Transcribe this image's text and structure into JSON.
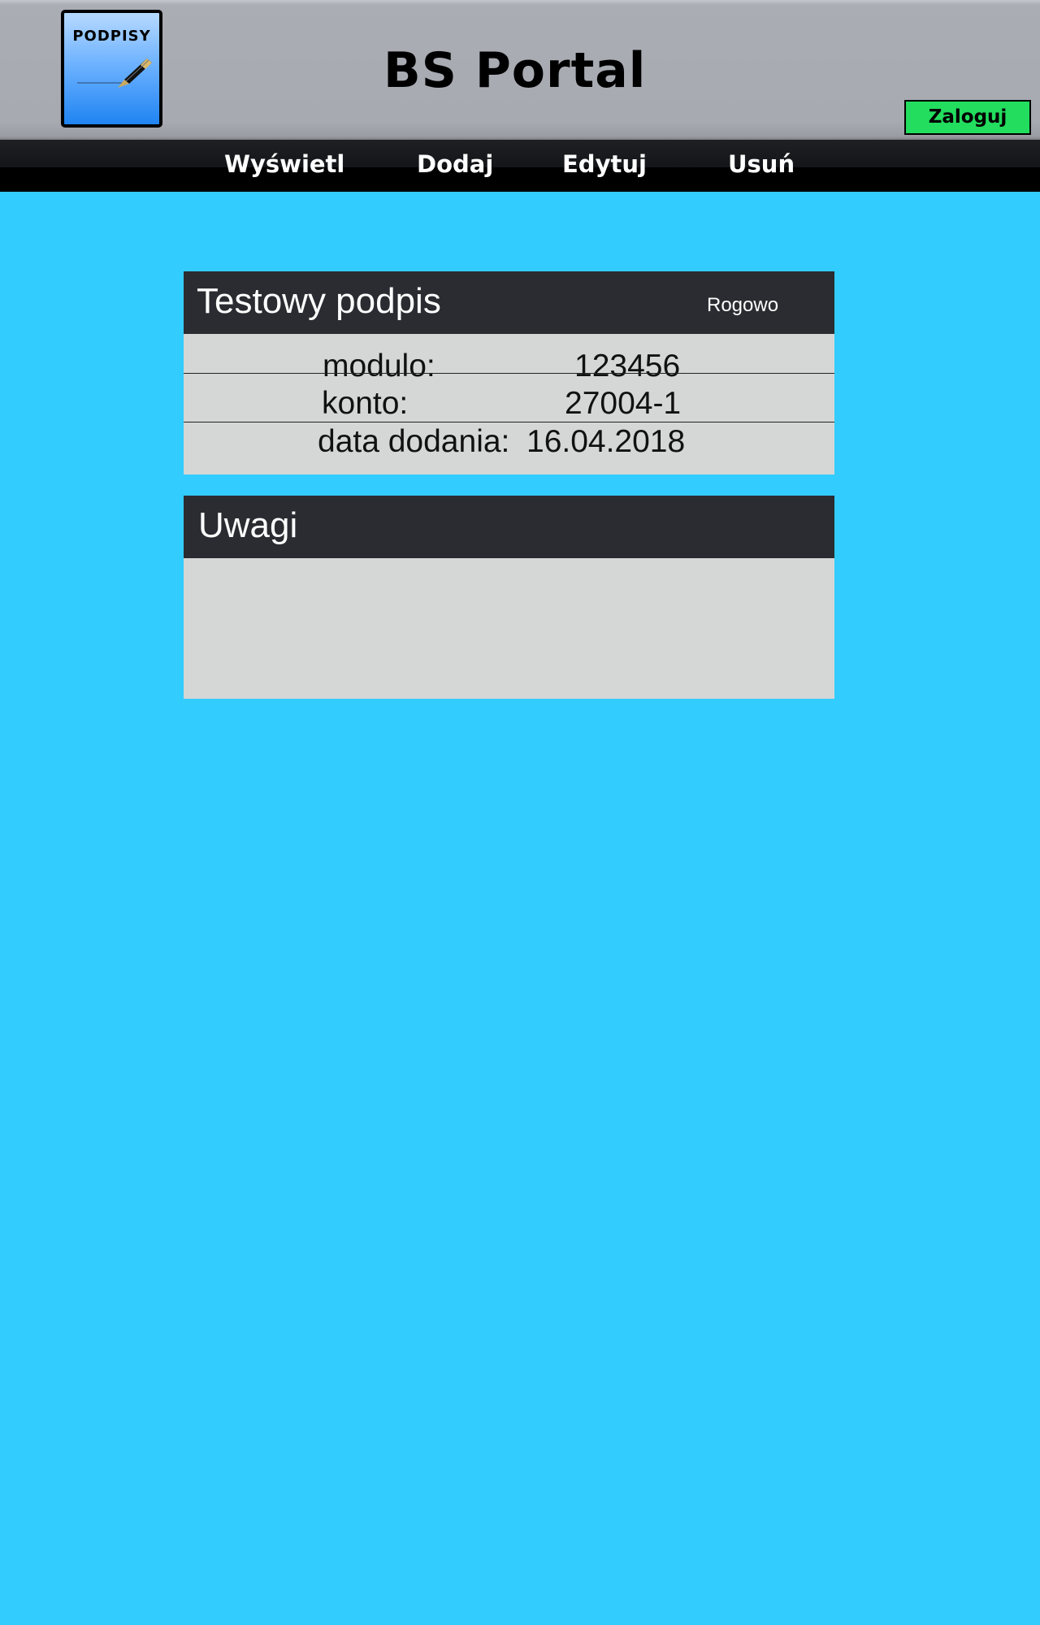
{
  "header": {
    "logo_text": "PODPISY",
    "title": "BS Portal",
    "login_label": "Zaloguj"
  },
  "nav": {
    "items": [
      "Wyświetl",
      "Dodaj",
      "Edytuj",
      "Usuń"
    ]
  },
  "signature_card": {
    "title": "Testowy podpis",
    "location": "Rogowo",
    "rows": [
      {
        "label": "modulo:",
        "value": "123456"
      },
      {
        "label": "konto:",
        "value": "27004-1"
      },
      {
        "label": "data dodania:",
        "value": "16.04.2018"
      }
    ]
  },
  "notes_card": {
    "title": "Uwagi",
    "content": ""
  },
  "colors": {
    "page_background": "#33ccff",
    "login_button": "#22dd5e",
    "card_header": "#2a2c31",
    "card_body": "#d5d7d6"
  },
  "icons": {
    "logo": "pen-signature-icon"
  }
}
